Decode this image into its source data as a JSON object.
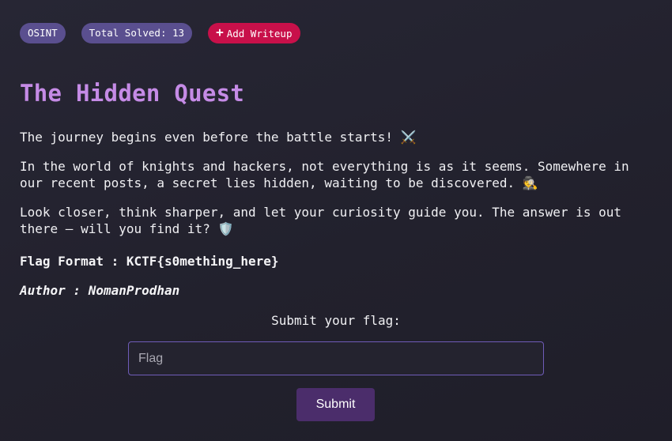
{
  "badges": {
    "category": "OSINT",
    "solved": "Total Solved: 13",
    "writeup_icon": "+",
    "writeup_label": "Add Writeup"
  },
  "challenge": {
    "title": "The Hidden Quest",
    "paragraph1": "The journey begins even before the battle starts! ⚔️",
    "paragraph2": "In the world of knights and hackers, not everything is as it seems. Somewhere in our recent posts, a secret lies hidden, waiting to be discovered. 🕵️",
    "paragraph3": "Look closer, think sharper, and let your curiosity guide you. The answer is out there – will you find it? 🛡️",
    "flag_format": "Flag Format : KCTF{s0mething_here}",
    "author": "Author : NomanProdhan"
  },
  "submission": {
    "label": "Submit your flag:",
    "placeholder": "Flag",
    "value": "",
    "button_label": "Submit"
  },
  "colors": {
    "title": "#c58be6",
    "badge": "#5a4f8f",
    "writeup": "#c8104a",
    "submit": "#4b2d6b",
    "input_border": "#6f5cb8"
  }
}
